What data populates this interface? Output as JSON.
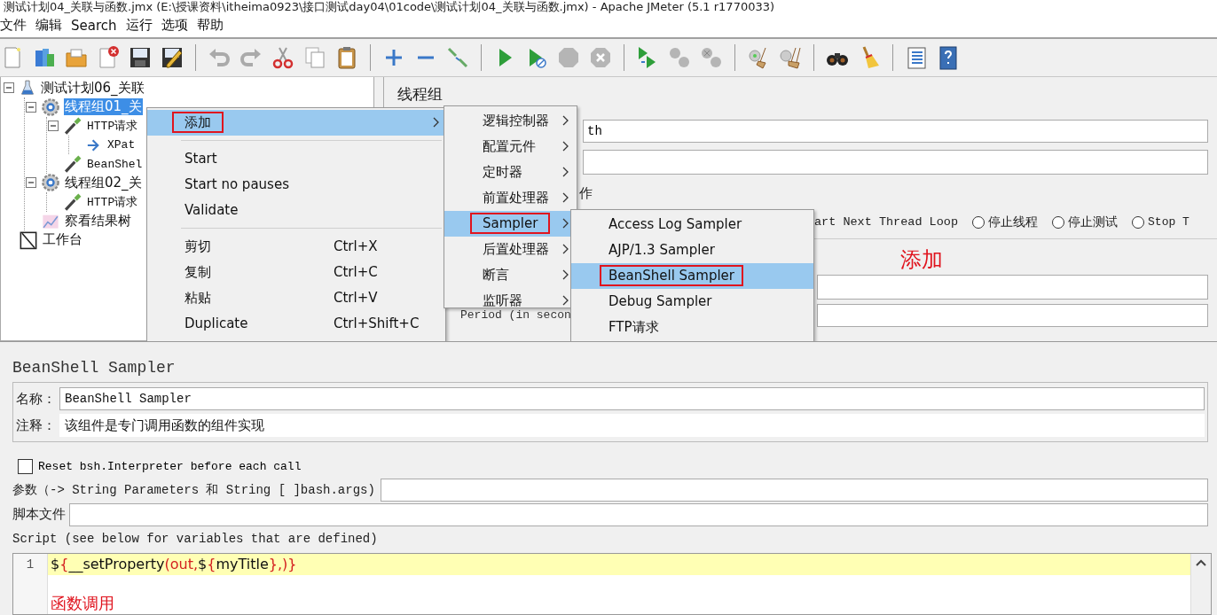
{
  "window": {
    "title": "测试计划04_关联与函数.jmx (E:\\授课资料\\itheima0923\\接口测试day04\\01code\\测试计划04_关联与函数.jmx) - Apache JMeter (5.1 r1770033)"
  },
  "menu_bar": [
    "文件",
    "编辑",
    "Search",
    "运行",
    "选项",
    "帮助"
  ],
  "tree": {
    "items": [
      {
        "label": "测试计划06_关联",
        "kind": "plan",
        "expanded": true,
        "selected": false,
        "children": [
          {
            "label": "线程组01_关",
            "kind": "thread_group",
            "expanded": true,
            "selected": true,
            "children": [
              {
                "label": "HTTP请求",
                "kind": "sampler",
                "expanded": true,
                "selected": false,
                "children": [
                  {
                    "label": "XPat",
                    "kind": "extractor",
                    "selected": false
                  }
                ]
              },
              {
                "label": "BeanShel",
                "kind": "sampler",
                "selected": false
              }
            ]
          },
          {
            "label": "线程组02_关",
            "kind": "thread_group",
            "expanded": true,
            "selected": false,
            "children": [
              {
                "label": "HTTP请求",
                "kind": "sampler",
                "selected": false
              }
            ]
          },
          {
            "label": "察看结果树",
            "kind": "listener",
            "selected": false
          }
        ]
      },
      {
        "label": "工作台",
        "kind": "workbench",
        "selected": false
      }
    ]
  },
  "thread_group_panel": {
    "title": "线程组",
    "name_value": "th",
    "section_label": "作",
    "error_actions": [
      {
        "kind": "text",
        "label": "art Next Thread Loop"
      },
      {
        "kind": "radio",
        "label": "停止线程",
        "selected": false
      },
      {
        "kind": "radio",
        "label": "停止测试",
        "selected": false
      },
      {
        "kind": "radio",
        "label": "Stop T",
        "selected": false
      }
    ],
    "period_label": "Period (in secon"
  },
  "context_menu": {
    "items": [
      {
        "kind": "item",
        "label": "添加",
        "submenu": true,
        "selected": true,
        "outlined": true
      },
      {
        "kind": "separator"
      },
      {
        "kind": "item",
        "label": "Start",
        "selected": false
      },
      {
        "kind": "item",
        "label": "Start no pauses",
        "selected": false
      },
      {
        "kind": "item",
        "label": "Validate",
        "selected": false
      },
      {
        "kind": "separator"
      },
      {
        "kind": "item",
        "label": "剪切",
        "shortcut": "Ctrl+X",
        "selected": false
      },
      {
        "kind": "item",
        "label": "复制",
        "shortcut": "Ctrl+C",
        "selected": false
      },
      {
        "kind": "item",
        "label": "粘贴",
        "shortcut": "Ctrl+V",
        "selected": false
      },
      {
        "kind": "item",
        "label": "Duplicate",
        "shortcut": "Ctrl+Shift+C",
        "selected": false
      }
    ]
  },
  "add_submenu": {
    "items": [
      {
        "label": "逻辑控制器",
        "submenu": true,
        "selected": false
      },
      {
        "label": "配置元件",
        "submenu": true,
        "selected": false
      },
      {
        "label": "定时器",
        "submenu": true,
        "selected": false
      },
      {
        "label": "前置处理器",
        "submenu": true,
        "selected": false
      },
      {
        "label": "Sampler",
        "submenu": true,
        "selected": true,
        "outlined": true
      },
      {
        "label": "后置处理器",
        "submenu": true,
        "selected": false
      },
      {
        "label": "断言",
        "submenu": true,
        "selected": false
      },
      {
        "label": "监听器",
        "submenu": true,
        "selected": false
      }
    ]
  },
  "sampler_submenu": {
    "items": [
      {
        "label": "Access Log Sampler",
        "selected": false
      },
      {
        "label": "AJP/1.3 Sampler",
        "selected": false
      },
      {
        "label": "BeanShell Sampler",
        "selected": true,
        "outlined": true
      },
      {
        "label": "Debug Sampler",
        "selected": false
      },
      {
        "label": "FTP请求",
        "selected": false
      }
    ]
  },
  "annotation": "添加",
  "sampler_panel": {
    "title": "BeanShell Sampler",
    "name_label": "名称：",
    "name_value": "BeanShell Sampler",
    "comment_label": "注释：",
    "comment_value": "该组件是专门调用函数的组件实现",
    "reset_checkbox": {
      "label": "Reset bsh.Interpreter before each call",
      "checked": false
    },
    "params_label": "参数（-> String Parameters 和 String [ ]bash.args)",
    "script_file_label": "脚本文件",
    "script_label": "Script (see below for variables that are defined)",
    "script": {
      "lines": [
        {
          "number": "1",
          "current": true,
          "tokens": [
            {
              "text": "$",
              "kind": "plain"
            },
            {
              "text": "{",
              "kind": "accent"
            },
            {
              "text": "__setProperty",
              "kind": "plain"
            },
            {
              "text": "(out,",
              "kind": "accent"
            },
            {
              "text": "$",
              "kind": "plain"
            },
            {
              "text": "{",
              "kind": "accent"
            },
            {
              "text": "myTitle",
              "kind": "plain"
            },
            {
              "text": "},)}",
              "kind": "accent"
            }
          ]
        }
      ],
      "annotation": "函数调用"
    }
  }
}
